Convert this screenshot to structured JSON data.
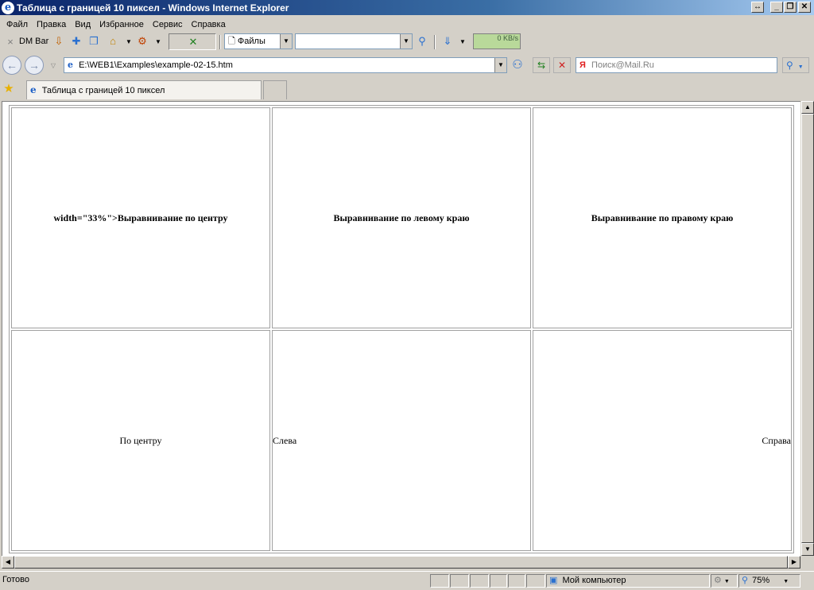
{
  "window": {
    "title": "Таблица с границей 10 пиксел - Windows Internet Explorer",
    "controls": [
      "↔",
      "_",
      "❐",
      "✕"
    ]
  },
  "menu": [
    "Файл",
    "Правка",
    "Вид",
    "Избранное",
    "Сервис",
    "Справка"
  ],
  "toolbar": {
    "dm_bar_label": "DM Bar",
    "files_label": "Файлы",
    "speed_label": "0 KB/s"
  },
  "address": {
    "url": "E:\\WEB1\\Examples\\example-02-15.htm",
    "search_placeholder": "Поиск@Mail.Ru"
  },
  "tab": {
    "title": "Таблица с границей 10 пиксел"
  },
  "table": {
    "rows": [
      [
        {
          "text": "width=\"33%\">Выравнивание по центру",
          "align": "center",
          "bold": true
        },
        {
          "text": "Выравнивание по левому краю",
          "align": "center",
          "bold": true
        },
        {
          "text": "Выравнивание по правому краю",
          "align": "center",
          "bold": true
        }
      ],
      [
        {
          "text": "По центру",
          "align": "center",
          "bold": false
        },
        {
          "text": "Слева",
          "align": "left",
          "bold": false
        },
        {
          "text": "Справа",
          "align": "right",
          "bold": false
        }
      ]
    ]
  },
  "status": {
    "text": "Готово",
    "zone": "Мой компьютер",
    "zoom": "75%"
  },
  "colors": {
    "titlebar_start": "#0a246a",
    "speed_meter": "#b9d99a"
  }
}
